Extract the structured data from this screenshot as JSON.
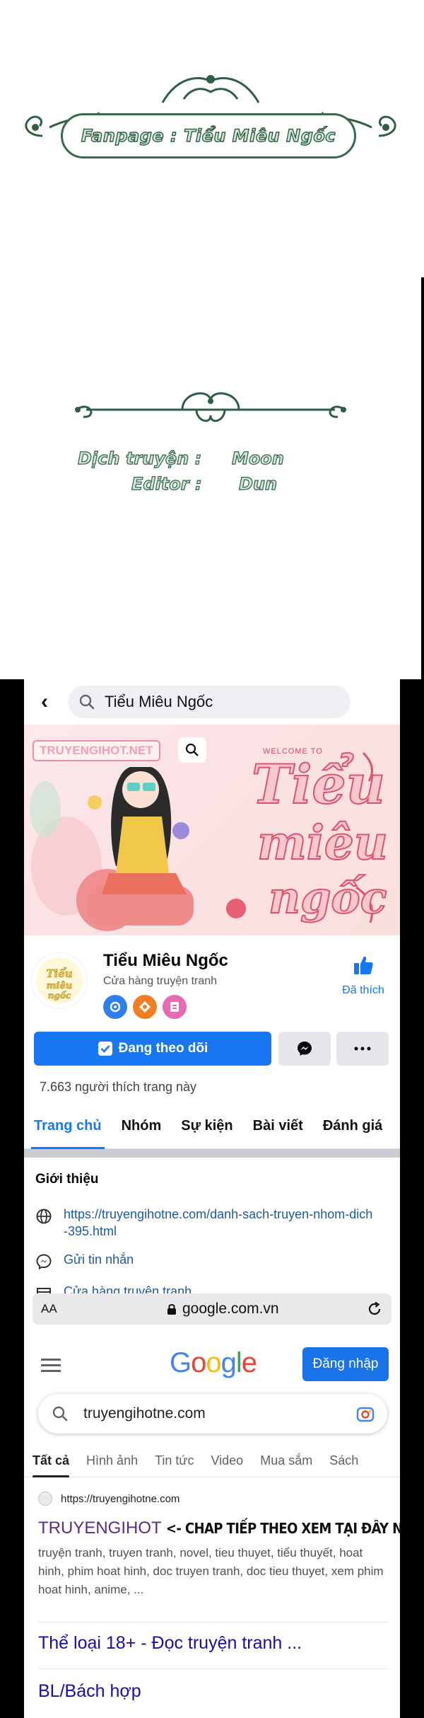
{
  "credits": {
    "fanpage": "Fanpage : Tiểu Miêu Ngốc",
    "rows": [
      {
        "role": "Dịch truyện :",
        "name": "Moon"
      },
      {
        "role": "Editor :",
        "name": "Dun"
      }
    ]
  },
  "facebook": {
    "search_text": "Tiểu Miêu Ngốc",
    "cover": {
      "watermark": "TRUYENGIHOT.NET",
      "welcome": "WELCOME TO",
      "logo_line1": "Tiểu",
      "logo_line2": "miêu",
      "logo_line3": "ngốc"
    },
    "page_name": "Tiểu Miêu Ngốc",
    "category": "Cửa hàng truyện tranh",
    "liked_label": "Đã thích",
    "follow_label": "Đang theo dõi",
    "likes_text": "7.663 người thích trang này",
    "tabs": [
      "Trang chủ",
      "Nhóm",
      "Sự kiện",
      "Bài viết",
      "Đánh giá"
    ],
    "active_tab": 0,
    "intro_title": "Giới thiệu",
    "intro_link": "https://truyengihotne.com/danh-sach-truyen-nhom-dich-395.html",
    "intro_messenger": "Gửi tin nhắn",
    "intro_category": "Cửa hàng truyện tranh"
  },
  "browser": {
    "aa": "AA",
    "url": "google.com.vn"
  },
  "google": {
    "signin": "Đăng nhập",
    "query": "truyengihotne.com",
    "tabs": [
      "Tất cả",
      "Hình ảnh",
      "Tin tức",
      "Video",
      "Mua sắm",
      "Sách"
    ],
    "result": {
      "source": "https://truyengihotne.com",
      "title": "TRUYENGIHOT",
      "annotation": "<- CHAP TIẾP THEO XEM TẠI ĐÂY NHA",
      "description": "truyện tranh, truyen tranh, novel, tieu thuyet, tiểu thuyết, hoat hinh, phim hoat hinh, doc truyen tranh, doc tieu thuyet, xem phim hoat hinh, anime, ..."
    },
    "links": [
      "Thể loại 18+ - Đọc truyện tranh ...",
      "BL/Bách hợp"
    ]
  },
  "colors": {
    "facebook_blue": "#1877f2",
    "google_blue": "#1a73e8",
    "ornament_green": "#2f5e44",
    "visited_purple": "#5b2c83"
  }
}
